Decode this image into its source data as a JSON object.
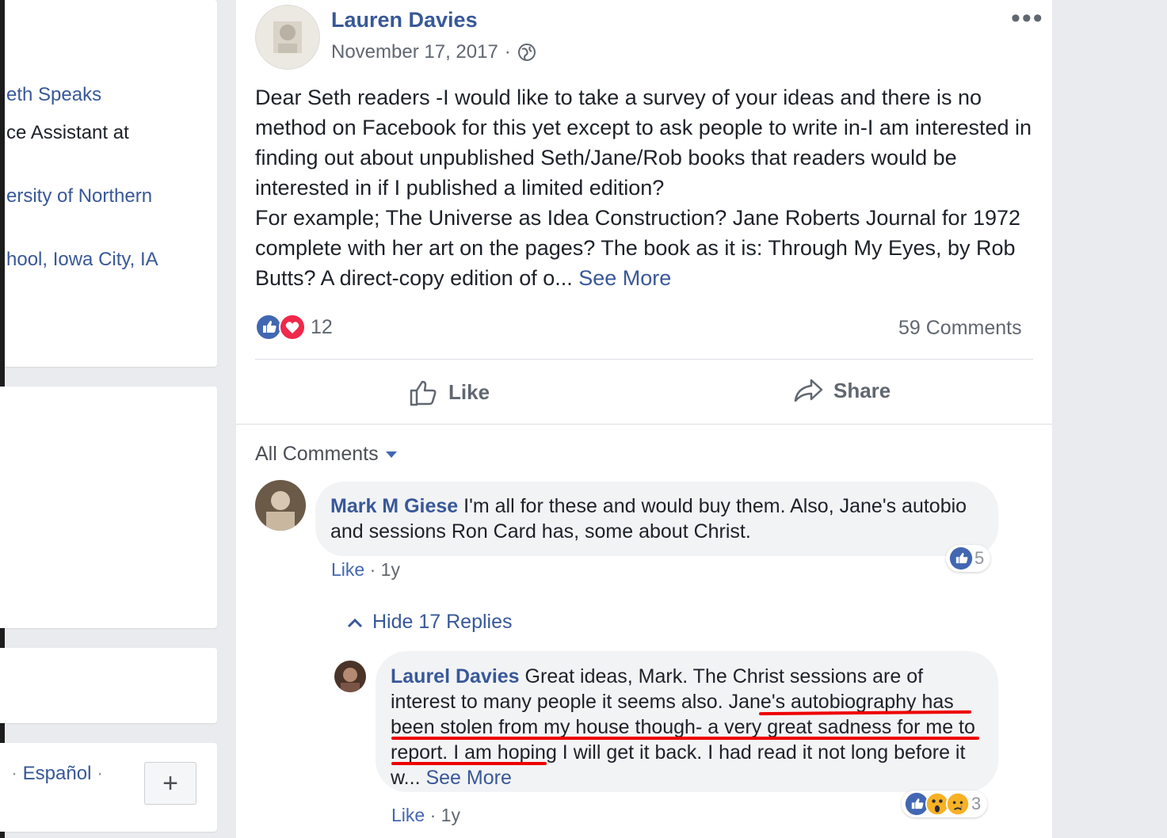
{
  "left_column": {
    "intro_lines": [
      "eth Speaks",
      "ce Assistant at",
      "ersity of Northern",
      "hool, Iowa City, IA"
    ],
    "languages": {
      "prefix": "·",
      "lang": "Español",
      "suffix": "·"
    },
    "add_button": "+"
  },
  "post": {
    "author": "Lauren Davies",
    "date": "November 17, 2017",
    "date_sep": "·",
    "privacy_icon": "globe-icon",
    "more_label": "•••",
    "body_lines": [
      "Dear Seth readers -I would like to take a survey of your ideas and there is no method on Facebook for this yet except to ask people to write in-I am interested in finding out about unpublished Seth/Jane/Rob books that readers would be interested in if I published a limited edition?",
      "For example; The Universe as Idea Construction? Jane Roberts Journal for 1972 complete with her art on the pages? The book as it is: Through My Eyes, by Rob Butts? A direct-copy edition of o..."
    ],
    "see_more": "See More",
    "reaction_count": "12",
    "reaction_icons": [
      "like-icon",
      "love-icon"
    ],
    "comments_count": "59 Comments",
    "actions": {
      "like": "Like",
      "share": "Share"
    }
  },
  "comments": {
    "filter_label": "All Comments",
    "items": [
      {
        "name": "Mark M Giese",
        "text": "I'm all for these and would buy them. Also, Jane's autobio and sessions Ron Card has, some about Christ.",
        "like_label": "Like",
        "sep": "·",
        "time": "1y",
        "reaction_count": "5"
      }
    ],
    "hide_replies": "Hide 17 Replies",
    "reply": {
      "name": "Laurel Davies",
      "text_a": "Great ideas, Mark. The Christ sessions are of interest to many people it seems also.",
      "text_underlined": "Jane's autobiography has been stolen from my house though- a very great sadness for me to report.",
      "text_b": "I am hoping I will get it back. I had read it not long before it w...",
      "see_more": "See More",
      "like_label": "Like",
      "sep": "·",
      "time": "1y",
      "reaction_count": "3"
    }
  },
  "colors": {
    "link": "#385898",
    "like_blue": "#4267b2",
    "love_red": "#f0284a",
    "underline": "#ee0000"
  }
}
